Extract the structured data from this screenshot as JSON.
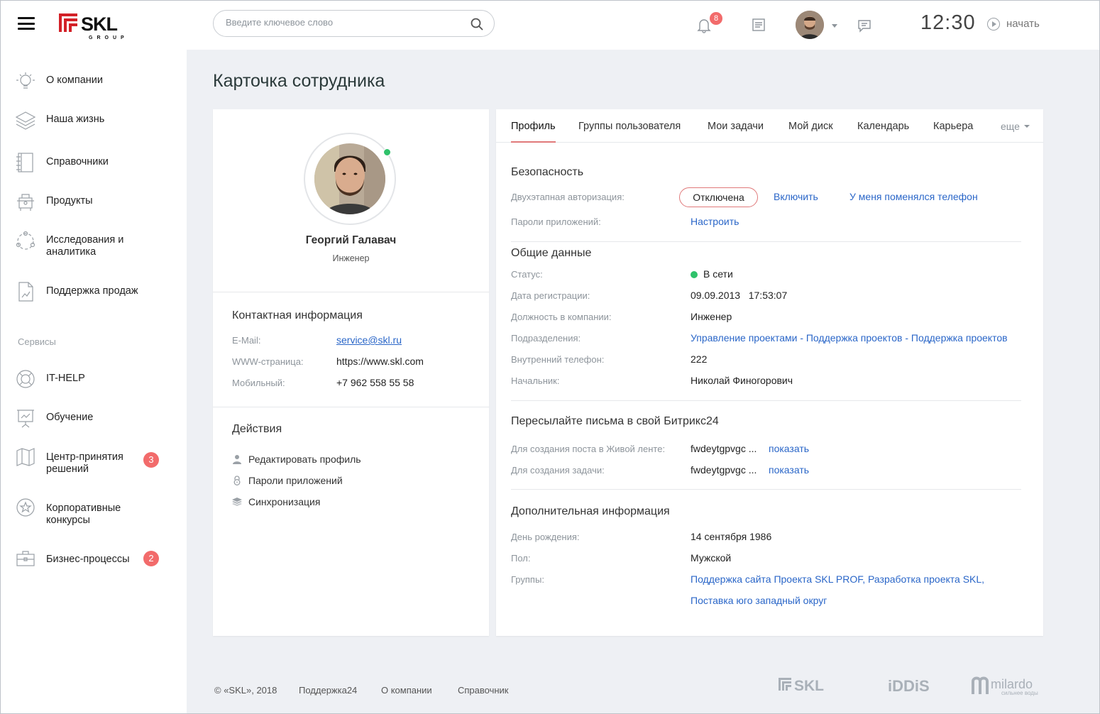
{
  "brand": {
    "logo_text": "SKL",
    "logo_sub": "GROUP"
  },
  "sidebar": {
    "items": [
      {
        "label": "О компании",
        "icon": "lightbulb-icon"
      },
      {
        "label": "Наша жизнь",
        "icon": "layers-icon"
      },
      {
        "label": "Справочники",
        "icon": "notebook-icon"
      },
      {
        "label": "Продукты",
        "icon": "cart-icon"
      },
      {
        "label": "Исследования и аналитика",
        "icon": "network-icon"
      },
      {
        "label": "Поддержка продаж",
        "icon": "document-chart-icon"
      }
    ],
    "services_label": "Сервисы",
    "services": [
      {
        "label": "IT-HELP",
        "icon": "lifebuoy-icon"
      },
      {
        "label": "Обучение",
        "icon": "presentation-icon"
      },
      {
        "label": "Центр-принятия решений",
        "icon": "map-icon",
        "badge": "3"
      },
      {
        "label": "Корпоративные конкурсы",
        "icon": "star-icon"
      },
      {
        "label": "Бизнес-процессы",
        "icon": "briefcase-icon",
        "badge": "2"
      }
    ]
  },
  "header": {
    "search_placeholder": "Введите ключевое слово",
    "notifications_count": "8",
    "time": "12:30",
    "start_label": "начать"
  },
  "page": {
    "title": "Карточка сотрудника"
  },
  "profile": {
    "name": "Георгий Галавач",
    "position": "Инженер",
    "contact_title": "Контактная информация",
    "contacts": [
      {
        "label": "E-Mail:",
        "value": "service@skl.ru"
      },
      {
        "label": "WWW-страница:",
        "value": "https://www.skl.com"
      },
      {
        "label": "Мобильный:",
        "value": "+7 962 558 55 58"
      }
    ],
    "actions_title": "Действия",
    "actions": [
      {
        "label": "Редактировать профиль",
        "icon": "user-icon"
      },
      {
        "label": "Пароли приложений",
        "icon": "lock-icon"
      },
      {
        "label": "Синхронизация",
        "icon": "layers-icon"
      }
    ]
  },
  "tabs": {
    "items": [
      "Профиль",
      "Группы пользователя",
      "Мои задачи",
      "Мой диск",
      "Календарь",
      "Карьера"
    ],
    "more": "еще"
  },
  "security": {
    "title": "Безопасность",
    "twofa_label": "Двухэтапная авторизация:",
    "twofa_status": "Отключена",
    "enable_link": "Включить",
    "phone_changed_link": "У меня поменялся телефон",
    "app_passwords_label": "Пароли приложений:",
    "configure_link": "Настроить"
  },
  "general": {
    "title": "Общие данные",
    "status_label": "Статус:",
    "status_value": "В сети",
    "reg_label": "Дата регистрации:",
    "reg_value": "09.09.2013   17:53:07",
    "pos_label": "Должность в компании:",
    "pos_value": "Инженер",
    "dept_label": "Подразделения:",
    "dept_value": "Управление проектами - Поддержка проектов - Поддержка проектов",
    "phone_label": "Внутренний телефон:",
    "phone_value": "222",
    "boss_label": "Начальник:",
    "boss_value": "Николай Финогорович"
  },
  "forward": {
    "title": "Пересылайте письма в свой Битрикс24",
    "post_label": "Для создания поста в Живой ленте:",
    "post_value": "fwdeytgpvgc ...",
    "task_label": "Для создания задачи:",
    "task_value": "fwdeytgpvgc ...",
    "show_link": "показать"
  },
  "extra": {
    "title": "Дополнительная информация",
    "birthday_label": "День рождения:",
    "birthday_value": "14 сентября 1986",
    "gender_label": "Пол:",
    "gender_value": "Мужской",
    "groups_label": "Группы:",
    "groups_line1": "Поддержка сайта Проекта SKL PROF, Разработка проекта SKL,",
    "groups_line2": "Поставка юго западный округ"
  },
  "footer": {
    "copyright": "© «SKL», 2018",
    "links": [
      "Поддержка24",
      "О компании",
      "Справочник"
    ],
    "logos": [
      "SKL",
      "iDDiS",
      "milardo"
    ],
    "milardo_tagline": "сильнее воды"
  },
  "colors": {
    "accent_red": "#e0797a",
    "badge_red": "#f26b6b",
    "link_blue": "#2a66c8",
    "online_green": "#2fc26b",
    "logo_red": "#d32027"
  }
}
